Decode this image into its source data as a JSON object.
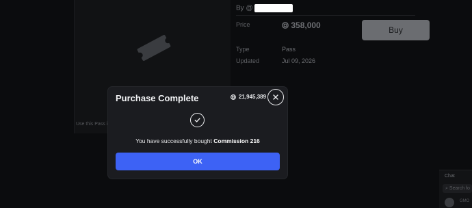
{
  "item": {
    "by_prefix": "By @",
    "price_label": "Price",
    "price_value": "358,000",
    "buy_label": "Buy",
    "type_label": "Type",
    "type_value": "Pass",
    "updated_label": "Updated",
    "updated_value": "Jul 09, 2026",
    "caption": "Use this Pass in"
  },
  "chat": {
    "title": "Chat",
    "search_placeholder": "Search fo",
    "user_name": "GMO"
  },
  "modal": {
    "title": "Purchase Complete",
    "balance": "21,945,389",
    "message_prefix": "You have successfully bought ",
    "item_name": "Commission 216",
    "ok_label": "OK"
  },
  "colors": {
    "accent": "#3d62f5",
    "modal_bg": "#1b1c20",
    "page_bg": "#0b0c0e"
  },
  "icons": {
    "close": "close-icon",
    "check": "checkmark-icon",
    "currency": "robux-icon",
    "pass": "pass-ticket-icon"
  }
}
